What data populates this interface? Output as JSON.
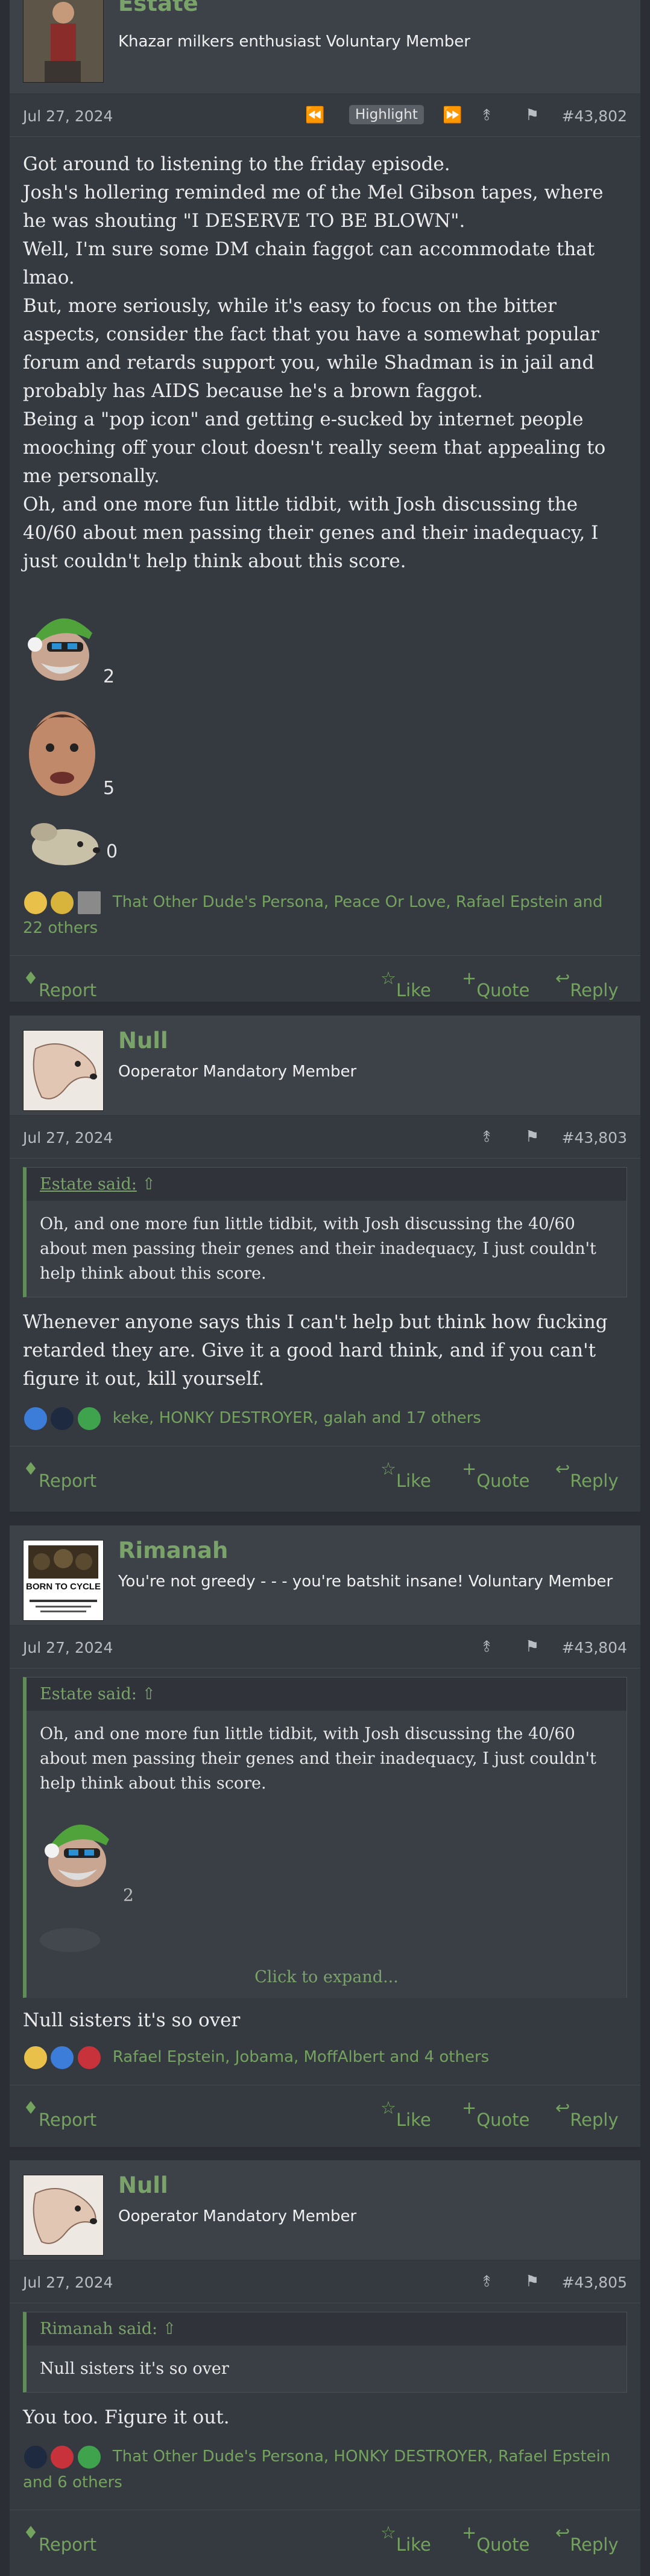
{
  "posts": [
    {
      "username": "Estate",
      "user_title": "Khazar milkers enthusiast Voluntary Member",
      "date": "Jul 27, 2024",
      "highlight": "Highlight",
      "post_number": "#43,802",
      "paragraphs": [
        "Got around to listening to the friday episode.",
        "Josh's hollering reminded me of the Mel Gibson tapes, where he was shouting \"I DESERVE TO BE BLOWN\".",
        "Well, I'm sure some DM chain faggot can accommodate that lmao.",
        "But, more seriously, while it's easy to focus on the bitter aspects, consider the fact that you have a somewhat popular forum and retards support you, while Shadman is in jail and probably has AIDS because he's a brown faggot.",
        "Being a \"pop icon\" and getting e-sucked by internet people mooching off your clout doesn't really seem that appealing to me personally.",
        "Oh, and one more fun little tidbit, with Josh discussing the 40/60 about men passing their genes and their inadequacy, I just couldn't help think about this score."
      ],
      "ratings": [
        "2",
        "5",
        "0"
      ],
      "reactions": "That Other Dude's Persona, Peace Or Love, Rafael Epstein and 22 others",
      "actions": {
        "report": "Report",
        "like": "Like",
        "quote": "Quote",
        "reply": "Reply"
      }
    },
    {
      "username": "Null",
      "user_title": "Ooperator Mandatory Member",
      "date": "Jul 27, 2024",
      "post_number": "#43,803",
      "quote_author": "Estate said:",
      "quote_text": "Oh, and one more fun little tidbit, with Josh discussing the 40/60 about men passing their genes and their inadequacy, I just couldn't help think about this score.",
      "body": "Whenever anyone says this I can't help but think how fucking retarded they are. Give it a good hard think, and if you can't figure it out, kill yourself.",
      "reactions": "keke, HONKY DESTROYER, galah and 17 others",
      "actions": {
        "report": "Report",
        "like": "Like",
        "quote": "Quote",
        "reply": "Reply"
      }
    },
    {
      "username": "Rimanah",
      "user_title": "You're not greedy - - - you're batshit insane! Voluntary Member",
      "avatar_text": "BORN TO CYCLE",
      "date": "Jul 27, 2024",
      "post_number": "#43,804",
      "quote_author": "Estate said:",
      "quote_text": "Oh, and one more fun little tidbit, with Josh discussing the 40/60 about men passing their genes and their inadequacy, I just couldn't help think about this score.",
      "quote_rating": "2",
      "expand": "Click to expand...",
      "body": "Null sisters it's so over",
      "reactions": "Rafael Epstein, Jobama, MoffAlbert and 4 others",
      "actions": {
        "report": "Report",
        "like": "Like",
        "quote": "Quote",
        "reply": "Reply"
      }
    },
    {
      "username": "Null",
      "user_title": "Ooperator Mandatory Member",
      "date": "Jul 27, 2024",
      "post_number": "#43,805",
      "quote_author": "Rimanah said:",
      "quote_text": "Null sisters it's so over",
      "body": "You too. Figure it out.",
      "reactions": "That Other Dude's Persona, HONKY DESTROYER, Rafael Epstein and 6 others",
      "actions": {
        "report": "Report",
        "like": "Like",
        "quote": "Quote",
        "reply": "Reply"
      }
    }
  ]
}
